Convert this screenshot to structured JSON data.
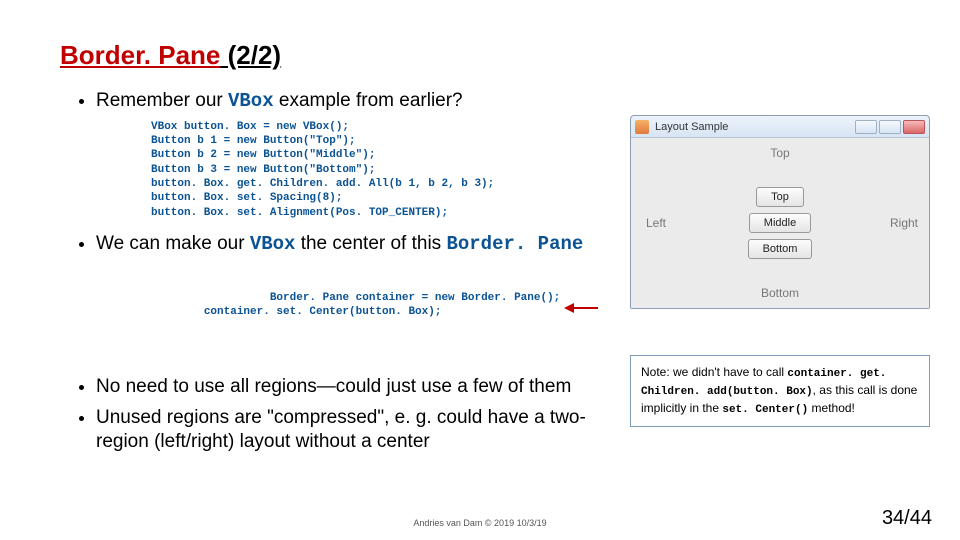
{
  "title": {
    "term": "Border. Pane",
    "suffix": " (2/2)"
  },
  "bullets": {
    "b1_pre": "Remember our ",
    "b1_code": "VBox",
    "b1_post": " example from earlier?",
    "b2_pre": "We can make our ",
    "b2_code1": "VBox",
    "b2_mid": " the center of this ",
    "b2_code2": "Border. Pane",
    "b3": "No need to use all regions—could just use a few of them",
    "b4": "Unused regions are \"compressed\", e. g. could have a two-region (left/right) layout without a center"
  },
  "code1": "VBox button. Box = new VBox();\nButton b 1 = new Button(\"Top\");\nButton b 2 = new Button(\"Middle\");\nButton b 3 = new Button(\"Bottom\");\nbutton. Box. get. Children. add. All(b 1, b 2, b 3);\nbutton. Box. set. Spacing(8);\nbutton. Box. set. Alignment(Pos. TOP_CENTER);",
  "code2": "Border. Pane container = new Border. Pane();\ncontainer. set. Center(button. Box);",
  "note": {
    "l1": "Note: we didn't have to call",
    "c1": "container. get. Children. add(button. Box)",
    "l2": ", as this call is done implicitly in the ",
    "c2": "set. Center()",
    "l3": " method!"
  },
  "window": {
    "title": "Layout Sample",
    "regions": {
      "top": "Top",
      "left": "Left",
      "right": "Right",
      "bottom": "Bottom"
    },
    "buttons": [
      "Top",
      "Middle",
      "Bottom"
    ]
  },
  "footer": "Andries van Dam © 2019 10/3/19",
  "page": "34/44"
}
